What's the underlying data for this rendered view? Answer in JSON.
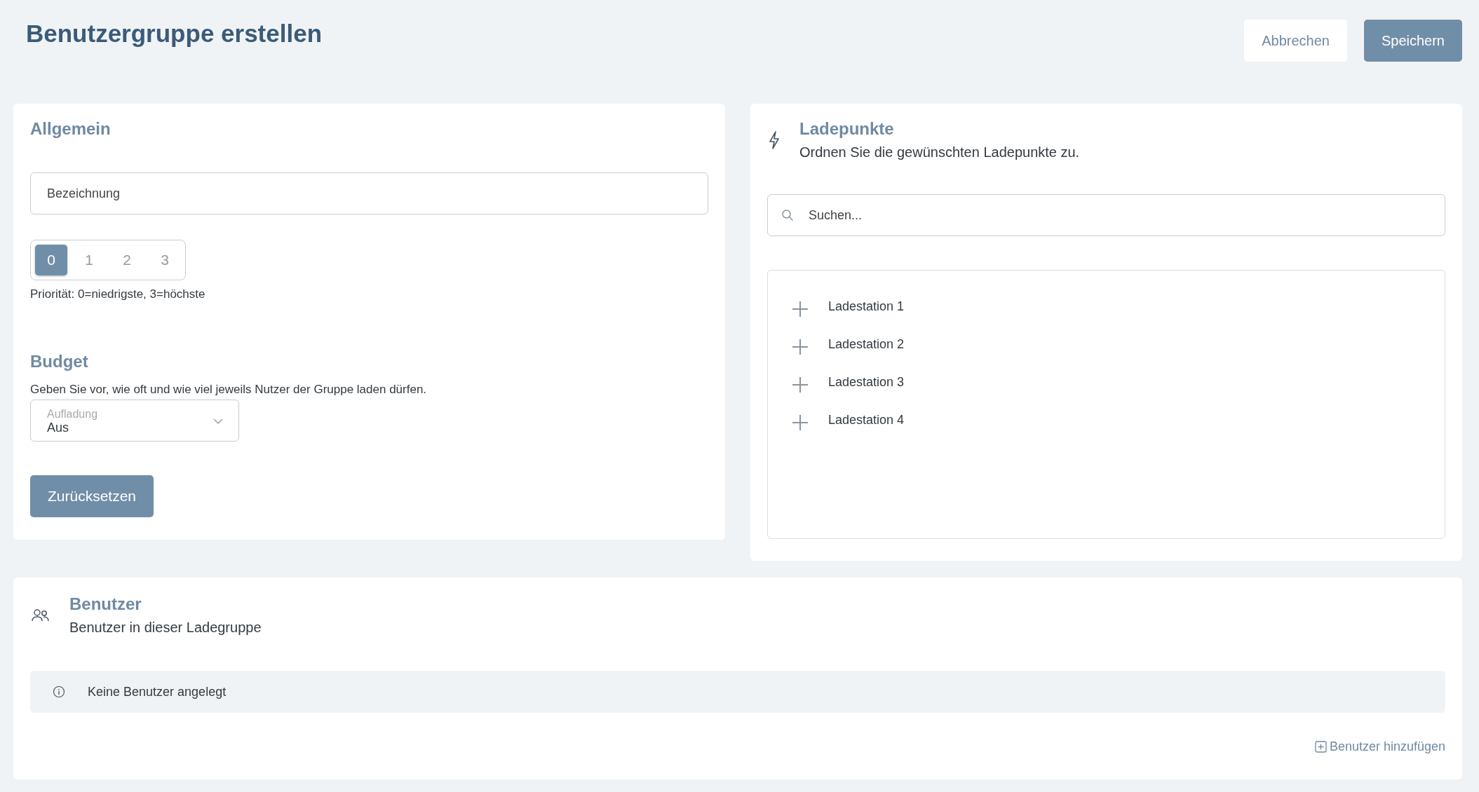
{
  "page": {
    "title": "Benutzergruppe erstellen"
  },
  "header_buttons": [
    {
      "label": "Abbrechen",
      "kind": "secondary"
    },
    {
      "label": "Speichern",
      "kind": "primary"
    }
  ],
  "general": {
    "title": "Allgemein",
    "name_field": {
      "placeholder": "Bezeichnung"
    },
    "priority": {
      "options": [
        {
          "label": "0",
          "selected": true
        },
        {
          "label": "1",
          "selected": false
        },
        {
          "label": "2",
          "selected": false
        },
        {
          "label": "3",
          "selected": false
        }
      ],
      "hint": "Priorität: 0=niedrigste, 3=höchste"
    },
    "budget_title": "Budget",
    "budget_description": "Geben Sie vor, wie oft und wie viel jeweils Nutzer der Gruppe laden dürfen.",
    "charge_select": {
      "label": "Aufladung",
      "value": "Aus"
    },
    "reset_button": "Zurücksetzen"
  },
  "charge_points": {
    "title": "Ladepunkte",
    "subtitle": "Ordnen Sie die gewünschten Ladepunkte zu.",
    "search": {
      "placeholder": "Suchen..."
    },
    "items": [
      {
        "label": "Ladestation 1"
      },
      {
        "label": "Ladestation 2"
      },
      {
        "label": "Ladestation 3"
      },
      {
        "label": "Ladestation 4"
      }
    ]
  },
  "users": {
    "title": "Benutzer",
    "subtitle": "Benutzer in dieser Ladegruppe",
    "notice": "Keine Benutzer angelegt",
    "add_link": "Benutzer hinzufügen"
  }
}
